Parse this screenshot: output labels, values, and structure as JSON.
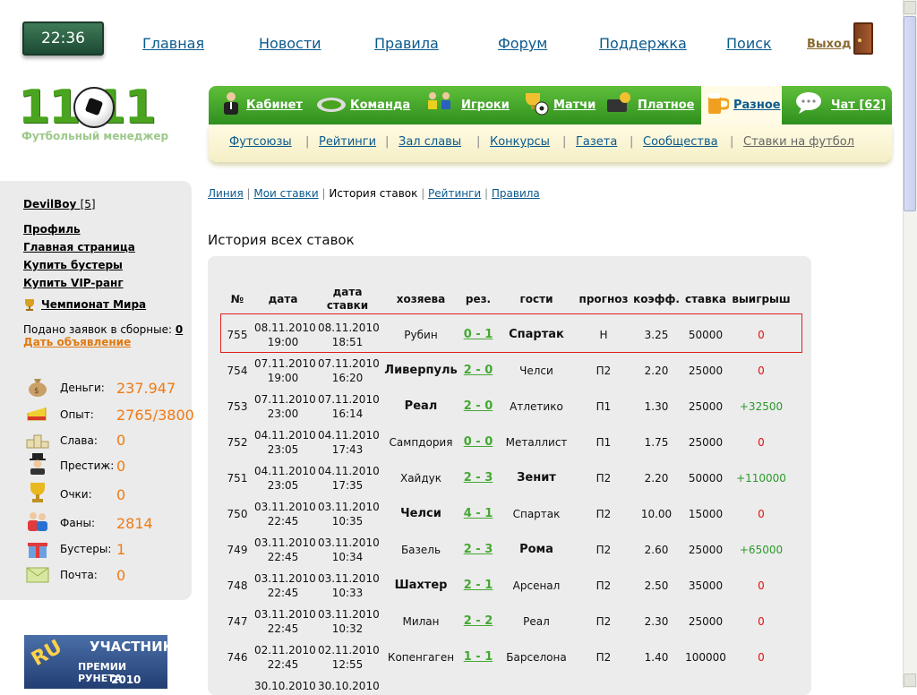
{
  "clock": "22:36",
  "top_nav": [
    {
      "label": "Главная"
    },
    {
      "label": "Новости"
    },
    {
      "label": "Правила"
    },
    {
      "label": "Форум"
    },
    {
      "label": "Поддержка"
    },
    {
      "label": "Поиск"
    }
  ],
  "exit_label": "Выход",
  "logo": {
    "text": "11 11",
    "subtitle": "Футбольный менеджер"
  },
  "main_menu": [
    {
      "label": "Кабинет",
      "icon": "manager-icon"
    },
    {
      "label": "Команда",
      "icon": "stadium-icon"
    },
    {
      "label": "Игроки",
      "icon": "players-icon"
    },
    {
      "label": "Матчи",
      "icon": "trophy-ball-icon"
    },
    {
      "label": "Платное",
      "icon": "wallet-icon"
    },
    {
      "label": "Разное",
      "icon": "beer-icon",
      "active": true
    },
    {
      "label": "Чат [62]",
      "icon": "chat-bubble-icon"
    }
  ],
  "sub_menu": [
    {
      "label": "Футсоюзы"
    },
    {
      "label": "Рейтинги"
    },
    {
      "label": "Зал славы"
    },
    {
      "label": "Конкурсы"
    },
    {
      "label": "Газета"
    },
    {
      "label": "Сообщества"
    },
    {
      "label": "Ставки на футбол"
    }
  ],
  "sidebar": {
    "username": "DevilBoy",
    "user_level": "[5]",
    "links": [
      "Профиль",
      "Главная страница",
      "Купить бустеры",
      "Купить VIP-ранг"
    ],
    "world_cup": "Чемпионат Мира",
    "requests_text": "Подано заявок в сборные:",
    "requests_count": "0",
    "ad_link": "Дать объявление",
    "stats": [
      {
        "label": "Деньги:",
        "value": "237.947",
        "icon": "money-bag-icon"
      },
      {
        "label": "Опыт:",
        "value": "2765/3800",
        "icon": "cheese-icon"
      },
      {
        "label": "Слава:",
        "value": "0",
        "icon": "podium-icon"
      },
      {
        "label": "Престиж:",
        "value": "0",
        "icon": "gentleman-icon"
      },
      {
        "label": "Очки:",
        "value": "0",
        "icon": "cup-icon"
      },
      {
        "label": "Фаны:",
        "value": "2814",
        "icon": "fans-icon"
      },
      {
        "label": "Бустеры:",
        "value": "1",
        "icon": "gift-icon"
      },
      {
        "label": "Почта:",
        "value": "0",
        "icon": "envelope-icon"
      }
    ],
    "award": {
      "ru": "RU",
      "line1": "УЧАСТНИК",
      "line2": "ПРЕМИИ РУНЕТА",
      "line3": "2010"
    }
  },
  "breadcrumb": [
    {
      "label": "Линия",
      "link": true
    },
    {
      "label": "Мои ставки",
      "link": true
    },
    {
      "label": "История ставок",
      "link": false
    },
    {
      "label": "Рейтинги",
      "link": true
    },
    {
      "label": "Правила",
      "link": true
    }
  ],
  "page_title": "История всех ставок",
  "table": {
    "headers": [
      "№",
      "дата",
      "дата ставки",
      "хозяева",
      "рез.",
      "гости",
      "прогноз",
      "коэфф.",
      "ставка",
      "выигрыш"
    ],
    "rows": [
      {
        "no": "755",
        "date": "08.11.2010",
        "time": "19:00",
        "bet_date": "08.11.2010",
        "bet_time": "18:51",
        "home": "Рубин",
        "result": "0 - 1",
        "away": "Спартак",
        "winner": "away",
        "forecast": "Н",
        "coef": "3.25",
        "stake": "50000",
        "win": "0",
        "highlighted": true
      },
      {
        "no": "754",
        "date": "07.11.2010",
        "time": "19:00",
        "bet_date": "07.11.2010",
        "bet_time": "16:20",
        "home": "Ливерпуль",
        "result": "2 - 0",
        "away": "Челси",
        "winner": "home",
        "forecast": "П2",
        "coef": "2.20",
        "stake": "25000",
        "win": "0"
      },
      {
        "no": "753",
        "date": "07.11.2010",
        "time": "23:00",
        "bet_date": "07.11.2010",
        "bet_time": "16:14",
        "home": "Реал",
        "result": "2 - 0",
        "away": "Атлетико",
        "winner": "home",
        "forecast": "П1",
        "coef": "1.30",
        "stake": "25000",
        "win": "+32500"
      },
      {
        "no": "752",
        "date": "04.11.2010",
        "time": "23:05",
        "bet_date": "04.11.2010",
        "bet_time": "17:43",
        "home": "Сампдория",
        "result": "0 - 0",
        "away": "Металлист",
        "winner": "none",
        "forecast": "П1",
        "coef": "1.75",
        "stake": "25000",
        "win": "0"
      },
      {
        "no": "751",
        "date": "04.11.2010",
        "time": "23:05",
        "bet_date": "04.11.2010",
        "bet_time": "17:35",
        "home": "Хайдук",
        "result": "2 - 3",
        "away": "Зенит",
        "winner": "away",
        "forecast": "П2",
        "coef": "2.20",
        "stake": "50000",
        "win": "+110000"
      },
      {
        "no": "750",
        "date": "03.11.2010",
        "time": "22:45",
        "bet_date": "03.11.2010",
        "bet_time": "10:35",
        "home": "Челси",
        "result": "4 - 1",
        "away": "Спартак",
        "winner": "home",
        "forecast": "П2",
        "coef": "10.00",
        "stake": "15000",
        "win": "0"
      },
      {
        "no": "749",
        "date": "03.11.2010",
        "time": "22:45",
        "bet_date": "03.11.2010",
        "bet_time": "10:34",
        "home": "Базель",
        "result": "2 - 3",
        "away": "Рома",
        "winner": "away",
        "forecast": "П2",
        "coef": "2.60",
        "stake": "25000",
        "win": "+65000"
      },
      {
        "no": "748",
        "date": "03.11.2010",
        "time": "22:45",
        "bet_date": "03.11.2010",
        "bet_time": "10:33",
        "home": "Шахтер",
        "result": "2 - 1",
        "away": "Арсенал",
        "winner": "home",
        "forecast": "П2",
        "coef": "2.50",
        "stake": "35000",
        "win": "0"
      },
      {
        "no": "747",
        "date": "03.11.2010",
        "time": "22:45",
        "bet_date": "03.11.2010",
        "bet_time": "10:32",
        "home": "Милан",
        "result": "2 - 2",
        "away": "Реал",
        "winner": "none",
        "forecast": "П2",
        "coef": "2.30",
        "stake": "25000",
        "win": "0"
      },
      {
        "no": "746",
        "date": "02.11.2010",
        "time": "22:45",
        "bet_date": "02.11.2010",
        "bet_time": "12:55",
        "home": "Копенгаген",
        "result": "1 - 1",
        "away": "Барселона",
        "winner": "none",
        "forecast": "П2",
        "coef": "1.40",
        "stake": "100000",
        "win": "0"
      },
      {
        "no": "",
        "date": "30.10.2010",
        "time": "",
        "bet_date": "30.10.2010",
        "bet_time": "",
        "home": "",
        "result": "",
        "away": "",
        "winner": "none",
        "forecast": "",
        "coef": "",
        "stake": "",
        "win": ""
      }
    ]
  },
  "colors": {
    "accent_green": "#4aa41f",
    "link_blue": "#0b5a8e",
    "stat_orange": "#f07a12",
    "loss_red": "#e01010",
    "win_green": "#2a9a2a"
  }
}
